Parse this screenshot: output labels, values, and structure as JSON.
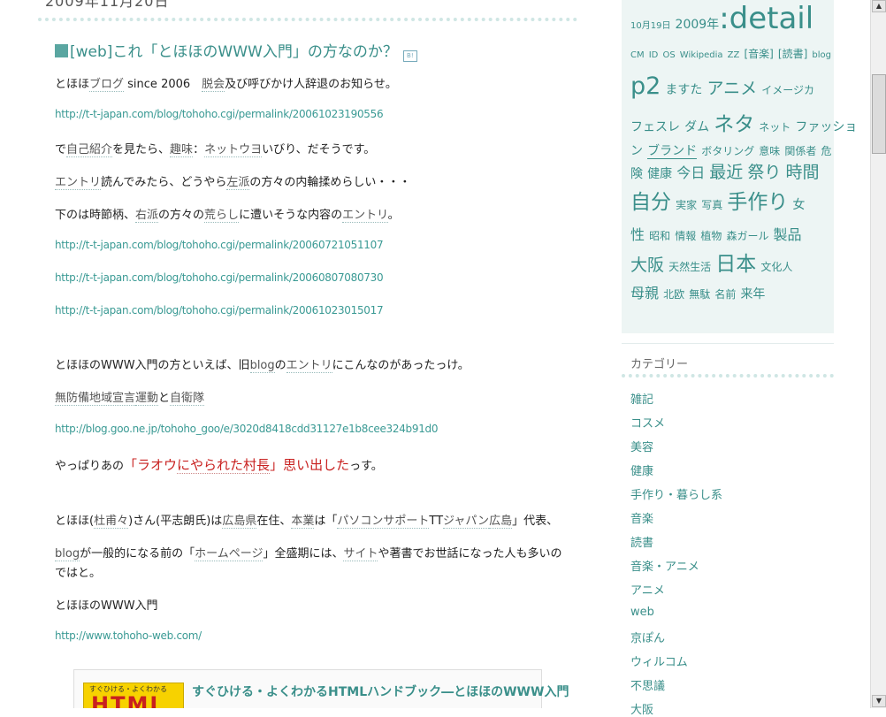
{
  "entry": {
    "date": "2009年11月20日",
    "title": "[web]これ「とほほのWWW入門」の方なのか？",
    "p1": {
      "a": "とほほ",
      "k1": "ブログ",
      "b": " since 2006　",
      "k2": "脱会",
      "c": "及び呼びかけ人辞退のお知らせ。"
    },
    "url1": "http://t-t-japan.com/blog/tohoho.cgi/permalink/20061023190556",
    "p2": {
      "a": "で",
      "k1": "自己紹介",
      "b": "を見たら、",
      "k2": "趣味",
      "c": "：",
      "k3": "ネットウヨ",
      "d": "いびり、だそうです。"
    },
    "p3": {
      "k1": "エントリ",
      "a": "読んでみたら、どうやら",
      "k2": "左派",
      "b": "の方々の内輪揉めらしい・・・"
    },
    "p4": {
      "a": "下のは時節柄、",
      "k1": "右派",
      "b": "の方々の",
      "k2": "荒らし",
      "c": "に遭いそうな内容の",
      "k3": "エントリ",
      "d": "。"
    },
    "url2": "http://t-t-japan.com/blog/tohoho.cgi/permalink/20060721051107",
    "url3": "http://t-t-japan.com/blog/tohoho.cgi/permalink/20060807080730",
    "url4": "http://t-t-japan.com/blog/tohoho.cgi/permalink/20061023015017",
    "p5": {
      "a": "とほほのWWW入門の方といえば、旧",
      "k1": "blog",
      "b": "の",
      "k2": "エントリ",
      "c": "にこんなのがあったっけ。"
    },
    "p6": {
      "k1": "無防備地域宣言",
      "k2": "運動",
      "a": "と",
      "k3": "自衛隊"
    },
    "url5": "http://blog.goo.ne.jp/tohoho_goo/e/3020d8418cdd31127e1b8cee324b91d0",
    "p7": {
      "a": "やっぱりあの",
      "r1": "「ラオウ",
      "k1": "にやられた",
      "r2": "村長",
      "r3": "」思い出した",
      "b": "っす。"
    },
    "p8": {
      "a": "とほほ(",
      "k1": "杜甫々",
      "b": ")さん(平志朗氏)は",
      "k2": "広島県",
      "c": "在住、",
      "k3": "本業",
      "d": "は「",
      "k4": "パソコンサポート",
      "e": "TT",
      "k5": "ジャパン",
      "k6": "広島",
      "f": "」代表、"
    },
    "p9": {
      "k1": "blog",
      "a": "が一般的になる前の「",
      "k2": "ホームページ",
      "b": "」全盛期には、",
      "k3": "サイト",
      "c": "や著書でお世話になった人も多いの"
    },
    "p9b": "ではと。",
    "p10": "とほほのWWW入門",
    "url6": "http://www.tohoho-web.com/",
    "book": {
      "cover_small": "すぐひける・よくわかる",
      "cover_big": "HTML",
      "title": "すぐひける・よくわかるHTMLハンドブック―とほほのWWW入門"
    }
  },
  "tags": {
    "l1": [
      "10月19日",
      "2009年",
      ":detail"
    ],
    "l2": [
      "CM",
      "ID",
      "OS",
      "Wikipedia",
      "ZZ",
      "[音楽]",
      "[読書]",
      "blog"
    ],
    "l3": [
      "p2",
      "ますた",
      "アニメ",
      "イメージカ"
    ],
    "l4": [
      "フェスレ",
      "ダム",
      "ネタ",
      "ネット",
      "ファッショ"
    ],
    "l5": [
      "ン",
      "ブランド",
      "ボタリング",
      "意味",
      "関係者",
      "危"
    ],
    "l6": [
      "険",
      "健康",
      "今日",
      "最近",
      "祭り",
      "時間"
    ],
    "l7": [
      "自分",
      "実家",
      "写真",
      "手作り",
      "女"
    ],
    "l8": [
      "性",
      "昭和",
      "情報",
      "植物",
      "森ガール",
      "製品"
    ],
    "l9": [
      "大阪",
      "天然生活",
      "日本",
      "文化人"
    ],
    "l10": [
      "母親",
      "北欧",
      "無駄",
      "名前",
      "来年"
    ]
  },
  "categories": {
    "title": "カテゴリー",
    "items": [
      "雑記",
      "コスメ",
      "美容",
      "健康",
      "手作り・暮らし系",
      "音楽",
      "読書",
      "音楽・アニメ",
      "アニメ",
      "web",
      "京ぽん",
      "ウィルコム",
      "不思議",
      "大阪"
    ]
  }
}
